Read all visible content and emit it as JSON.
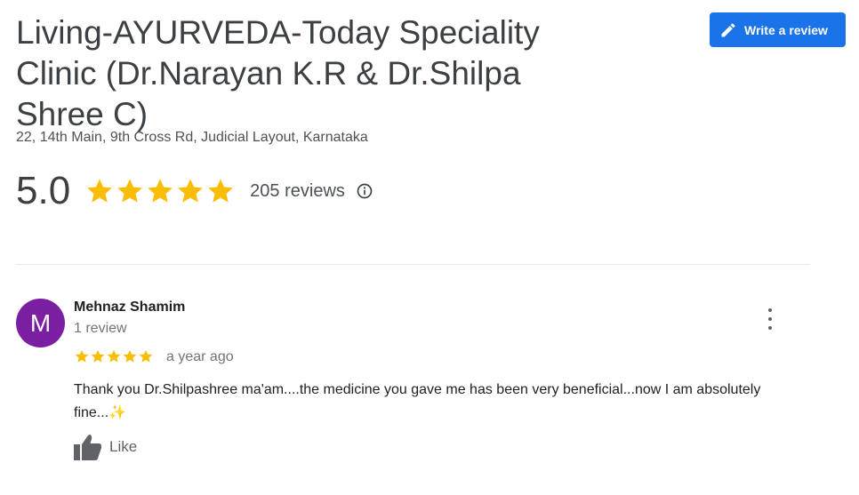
{
  "business": {
    "name": "Living-AYURVEDA-Today Speciality Clinic (Dr.Narayan K.R & Dr.Shilpa Shree C)",
    "address": "22, 14th Main, 9th Cross Rd, Judicial Layout, Karnataka",
    "write_review_label": "Write a review",
    "rating": "5.0",
    "stars": 5,
    "review_count": "205 reviews"
  },
  "review": {
    "avatar_letter": "M",
    "reviewer_name": "Mehnaz Shamim",
    "reviewer_meta": "1 review",
    "stars": 5,
    "time": "a year ago",
    "text": "Thank you Dr.Shilpashree ma'am....the medicine you gave me has been very beneficial...now I am absolutely fine...✨",
    "like_label": "Like"
  },
  "colors": {
    "accent": "#1a73e8",
    "star": "#fbbc04",
    "avatar": "#7b1fa2"
  },
  "icons": {
    "write": "pencil-icon",
    "info": "info-icon",
    "more": "more-vert-icon",
    "like": "thumbs-up-icon"
  }
}
